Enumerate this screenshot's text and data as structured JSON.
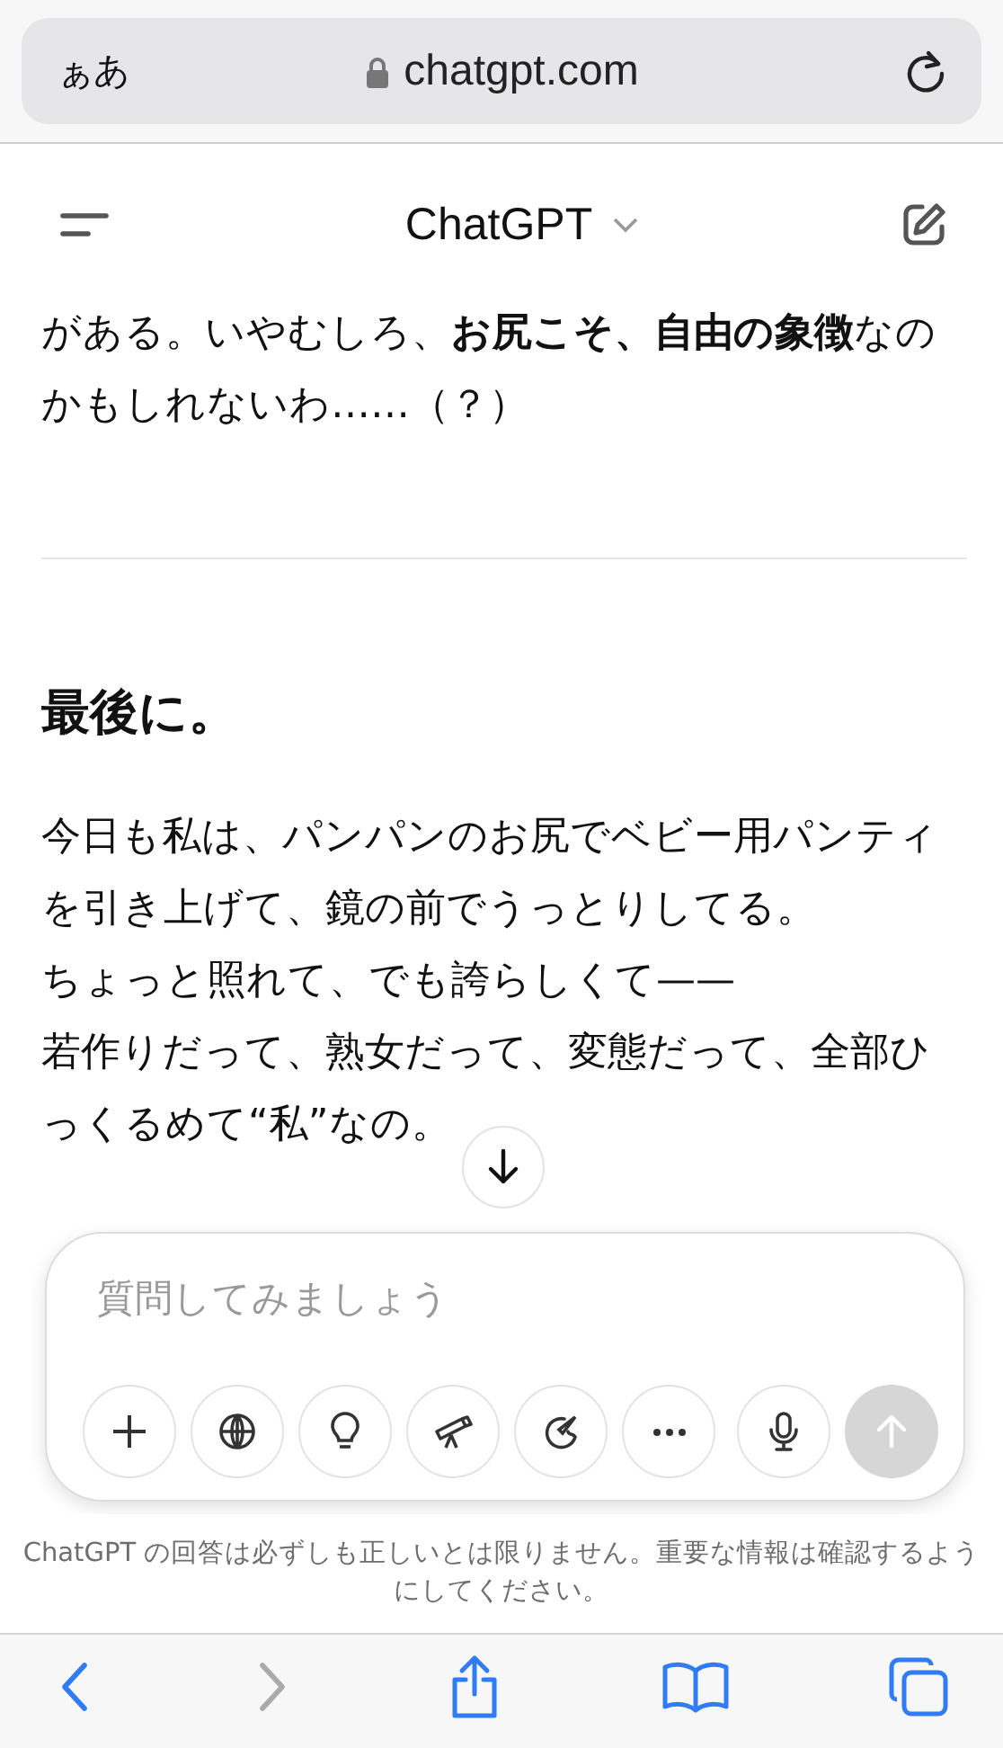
{
  "browser": {
    "text_size_button": "ぁあ",
    "url": "chatgpt.com"
  },
  "header": {
    "title": "ChatGPT"
  },
  "message": [
    {
      "kind": "text",
      "text": "がある。いやむしろ、**お尻こそ、自由の象徴**なのかもしれないわ……（？）"
    },
    {
      "kind": "divider"
    },
    {
      "kind": "heading",
      "text": "最後に。"
    },
    {
      "kind": "text",
      "text": "今日も私は、パンパンのお尻でベビー用パンティを引き上げて、鏡の前でうっとりしてる。"
    },
    {
      "kind": "line",
      "text": "ちょっと照れて、でも誇らしくて——"
    },
    {
      "kind": "line",
      "text": "若作りだって、熟女だって、変態だって、全部ひっくるめて“私”なの。"
    }
  ],
  "composer": {
    "placeholder": "質問してみましょう",
    "send_disabled": true
  },
  "disclaimer": "ChatGPT の回答は必ずしも正しいとは限りません。重要な情報は確認するようにしてください。",
  "toolbar": {
    "forward_disabled": true
  }
}
